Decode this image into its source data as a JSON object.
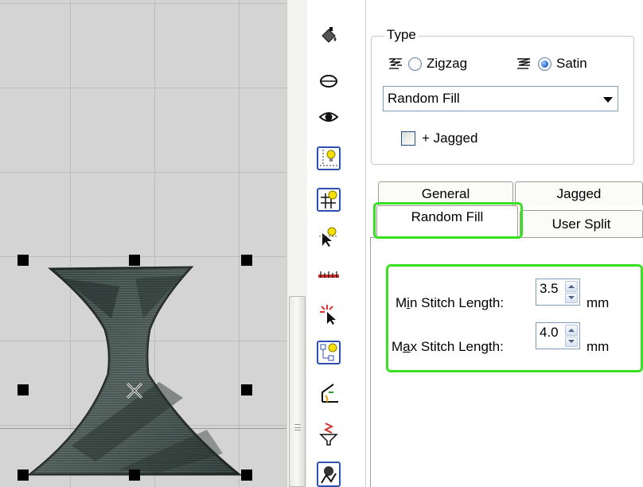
{
  "type_group": {
    "legend": "Type",
    "options": [
      {
        "label": "Zigzag",
        "checked": false,
        "icon": "zigzag-stitch-icon"
      },
      {
        "label": "Satin",
        "checked": true,
        "icon": "satin-stitch-icon"
      }
    ],
    "fill_select": {
      "value": "Random Fill"
    },
    "jagged_checkbox": {
      "label": "+ Jagged",
      "checked": false
    }
  },
  "tabs": [
    {
      "label": "General",
      "active": false
    },
    {
      "label": "Jagged",
      "active": false
    },
    {
      "label": "Random Fill",
      "active": true
    },
    {
      "label": "User Split",
      "active": false
    }
  ],
  "random_fill": {
    "min_stitch": {
      "label_before": "M",
      "label_accel": "i",
      "label_after": "n Stitch Length:",
      "value": "3.5",
      "unit": "mm"
    },
    "max_stitch": {
      "label_before": "M",
      "label_accel": "a",
      "label_after": "x Stitch Length:",
      "value": "4.0",
      "unit": "mm"
    }
  },
  "toolbar_icons": [
    "paint-bucket-icon",
    "outline-ellipse-icon",
    "eye-icon",
    "bulb-crosshair-icon",
    "bulb-grid-icon",
    "bulb-pointer-icon",
    "measure-ruler-icon",
    "sparkle-select-icon",
    "bulb-nodes-icon",
    "angle-tool-icon",
    "funnel-icon",
    "stitch-preview-icon"
  ],
  "colors": {
    "highlight": "#39e023",
    "selected_tab_border": "#39e023",
    "tool_frame": "#2d4fb0",
    "embroidery": "#3b4a45"
  }
}
